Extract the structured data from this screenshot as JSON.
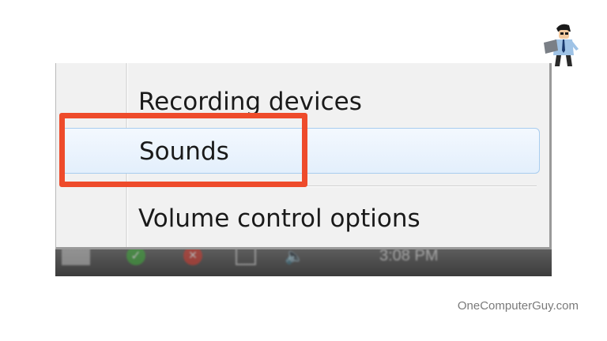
{
  "menu": {
    "items": [
      {
        "label": "Recording devices"
      },
      {
        "label": "Sounds",
        "highlighted": true
      },
      {
        "label": "Volume control options"
      }
    ]
  },
  "taskbar": {
    "tray_icons": [
      "flag-icon",
      "check-shield-icon",
      "error-icon",
      "network-icon",
      "speaker-icon"
    ],
    "clock": "3:08 PM"
  },
  "annotation": {
    "highlight_target": "Sounds",
    "highlight_color": "#ee4b2b"
  },
  "watermark": "OneComputerGuy.com",
  "logo_icon": "one-computer-guy-logo"
}
